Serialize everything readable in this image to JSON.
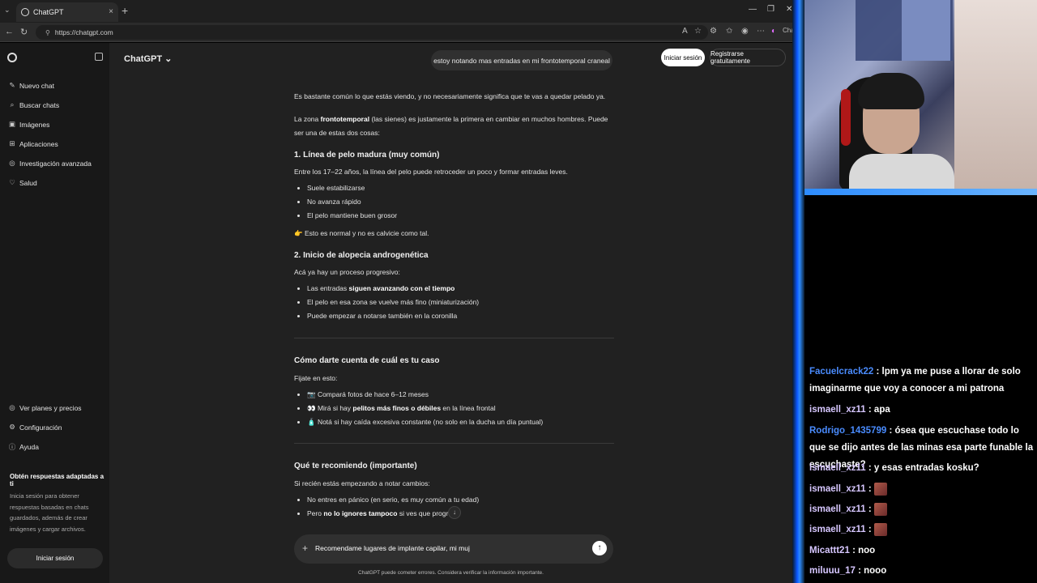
{
  "browser": {
    "tab_title": "ChatGPT",
    "url": "https://chatgpt.com",
    "new_tab": "+",
    "tab_close": "×",
    "extension_label": "Chat"
  },
  "sidebar": {
    "items": [
      {
        "icon": "✎",
        "label": "Nuevo chat"
      },
      {
        "icon": "⌕",
        "label": "Buscar chats"
      },
      {
        "icon": "▣",
        "label": "Imágenes"
      },
      {
        "icon": "⊞",
        "label": "Aplicaciones"
      },
      {
        "icon": "◎",
        "label": "Investigación avanzada"
      },
      {
        "icon": "♡",
        "label": "Salud"
      }
    ],
    "bottom_items": [
      {
        "icon": "◎",
        "label": "Ver planes y precios"
      },
      {
        "icon": "⚙",
        "label": "Configuración"
      },
      {
        "icon": "ⓘ",
        "label": "Ayuda"
      }
    ],
    "promo_title": "Obtén respuestas adaptadas a ti",
    "promo_body": "Inicia sesión para obtener respuestas basadas en chats guardados, además de crear imágenes y cargar archivos.",
    "login_label": "Iniciar sesión"
  },
  "header": {
    "model": "ChatGPT ⌄",
    "login": "Iniciar sesión",
    "register": "Registrarse gratuitamente"
  },
  "conversation": {
    "user_message": "estoy notando mas entradas en mi frontotemporal craneal",
    "p1": "Es bastante común lo que estás viendo, y no necesariamente significa que te vas a quedar pelado ya.",
    "p2_a": "La zona ",
    "p2_b": "frontotemporal",
    "p2_c": " (las sienes) es justamente la primera en cambiar en muchos hombres. Puede ser una de estas dos cosas:",
    "h1": "1. Línea de pelo madura (muy común)",
    "h1_intro": "Entre los 17–22 años, la línea del pelo puede retroceder un poco y formar entradas leves.",
    "h1_list": [
      "Suele estabilizarse",
      "No avanza rápido",
      "El pelo mantiene buen grosor"
    ],
    "h1_note": "👉 Esto es normal y no es calvicie como tal.",
    "h2": "2. Inicio de alopecia androgenética",
    "h2_intro": "Acá ya hay un proceso progresivo:",
    "h2_li1_a": "Las entradas ",
    "h2_li1_b": "siguen avanzando con el tiempo",
    "h2_li2": "El pelo en esa zona se vuelve más fino (miniaturización)",
    "h2_li3": "Puede empezar a notarse también en la coronilla",
    "h3": "Cómo darte cuenta de cuál es tu caso",
    "h3_intro": "Fijate en esto:",
    "h3_li1": "📷 Compará fotos de hace 6–12 meses",
    "h3_li2_a": "👀 Mirá si hay ",
    "h3_li2_b": "pelitos más finos o débiles",
    "h3_li2_c": " en la línea frontal",
    "h3_li3": "🧴 Notá si hay caída excesiva constante (no solo en la ducha un día puntual)",
    "h4": "Qué te recomiendo (importante)",
    "h4_intro": "Si recién estás empezando a notar cambios:",
    "h4_li1": "No entres en pánico (en serio, es muy común a tu edad)",
    "h4_li2_a": "Pero ",
    "h4_li2_b": "no lo ignores tampoco",
    "h4_li2_c": " si ves que progresa"
  },
  "composer": {
    "text": "Recomendame lugares de implante capilar, mi muj",
    "plus": "+",
    "send": "↑",
    "disclaimer": "ChatGPT puede cometer errores. Considera verificar la información importante."
  },
  "stream_chat": {
    "messages": [
      {
        "user": "Facuelcrack22",
        "text": ": lpm ya me puse a llorar de solo imaginarme que voy a conocer a mi patrona",
        "color": "#4a8cff"
      },
      {
        "user": "ismaell_xz11",
        "text": ": apa",
        "color": "#d7c7ff"
      },
      {
        "user": "Rodrigo_1435799",
        "text": ": ósea que escuchase todo lo que se dijo antes de las minas esa parte funable la escuchaste?",
        "color": "#4a8cff"
      },
      {
        "user": "ismaell_xz11",
        "text": ": y esas entradas kosku?",
        "color": "#d7c7ff"
      },
      {
        "user": "ismaell_xz11",
        "text": ":",
        "color": "#d7c7ff",
        "emote": true
      },
      {
        "user": "ismaell_xz11",
        "text": ":",
        "color": "#d7c7ff",
        "emote": true
      },
      {
        "user": "ismaell_xz11",
        "text": ":",
        "color": "#d7c7ff",
        "emote": true
      },
      {
        "user": "Micattt21",
        "text": ": noo",
        "color": "#d7c7ff"
      },
      {
        "user": "miluuu_17",
        "text": ": nooo",
        "color": "#d7c7ff"
      }
    ]
  },
  "colors": {
    "page_bg": "#212121",
    "sidebar_bg": "#181818",
    "accent_blue": "#0b57ff"
  }
}
